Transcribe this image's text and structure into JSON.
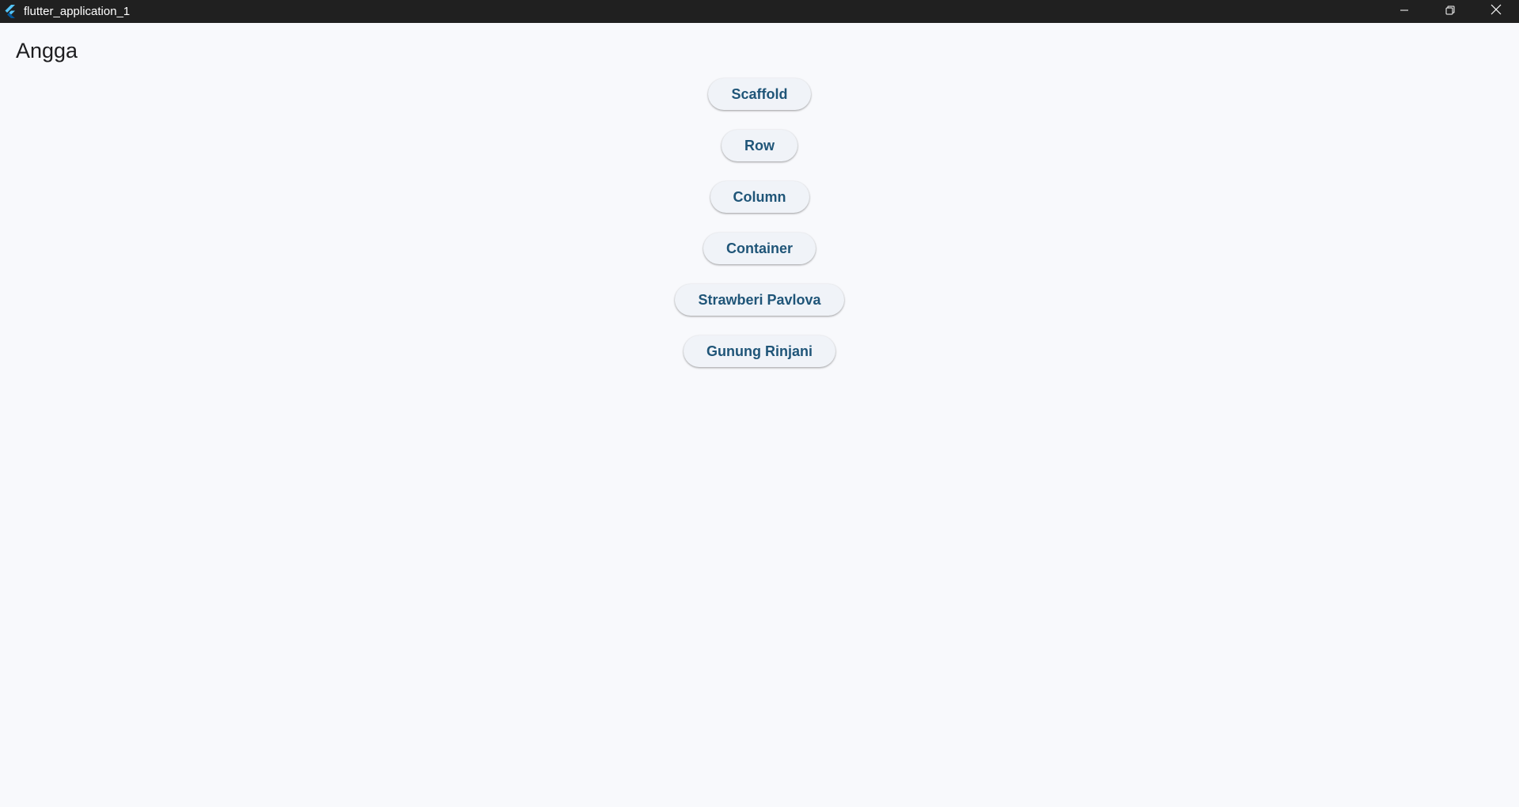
{
  "window": {
    "title": "flutter_application_1",
    "app_icon": "flutter-logo-icon",
    "controls": [
      "minimize-icon",
      "restore-icon",
      "close-icon"
    ]
  },
  "app": {
    "title": "Angga",
    "buttons": [
      {
        "label": "Scaffold"
      },
      {
        "label": "Row"
      },
      {
        "label": "Column"
      },
      {
        "label": "Container"
      },
      {
        "label": "Strawberi Pavlova"
      },
      {
        "label": "Gunung Rinjani"
      }
    ]
  },
  "colors": {
    "titlebar": "#202020",
    "background": "#f8f9fc",
    "button_bg": "#f0f3f8",
    "button_text": "#1f5578"
  }
}
